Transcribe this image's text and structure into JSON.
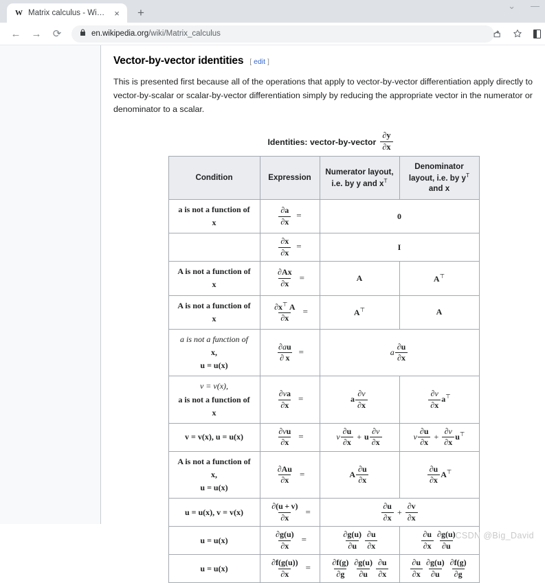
{
  "browser": {
    "tab": {
      "favicon": "W",
      "title": "Matrix calculus - Wikipedia",
      "close": "×"
    },
    "new_tab": "+",
    "window_controls": {
      "minimize_chevron": "⌄",
      "minimize": "—"
    },
    "nav": {
      "back": "←",
      "forward": "→",
      "reload": "⟳"
    },
    "address": {
      "lock": "🔒",
      "domain": "en.wikipedia.org",
      "path": "/wiki/Matrix_calculus"
    },
    "actions": {
      "share": "⤴",
      "bookmark": "☆",
      "sidepanel": "sidepanel"
    }
  },
  "article": {
    "section_title": "Vector-by-vector identities",
    "edit_open": "[",
    "edit_label": "edit",
    "edit_close": "]",
    "intro": "This is presented first because all of the operations that apply to vector-by-vector differentiation apply directly to vector-by-scalar or scalar-by-vector differentiation simply by reducing the appropriate vector in the numerator or denominator to a scalar.",
    "table_caption": "Identities: vector-by-vector",
    "caption_frac": {
      "num": "∂y",
      "den": "∂x"
    }
  },
  "table": {
    "headers": [
      "Condition",
      "Expression",
      "Numerator layout, i.e. by y and xᵀ",
      "Denominator layout, i.e. by yᵀ and x"
    ],
    "header_parts": {
      "numerator": {
        "line1": "Numerator layout,",
        "line2a": "i.e. by y and x",
        "line2b": "T"
      },
      "denominator": {
        "line1": "Denominator",
        "line2a": "layout, i.e. by y",
        "line2b": "T",
        "line3": "and x"
      }
    },
    "rows": [
      {
        "condition": "a is not a function of x",
        "condition_lines": [
          "a is not a function of",
          "x"
        ],
        "expression": "∂a / ∂x =",
        "expr_num": "∂a",
        "expr_den": "∂x",
        "merged": true,
        "result": "0"
      },
      {
        "condition": "",
        "condition_lines": [
          ""
        ],
        "expression": "∂x / ∂x =",
        "expr_num": "∂x",
        "expr_den": "∂x",
        "merged": true,
        "result": "I"
      },
      {
        "condition": "A is not a function of x",
        "condition_lines": [
          "A is not a function of",
          "x"
        ],
        "expression": "∂Ax / ∂x =",
        "expr_num": "∂Ax",
        "expr_den": "∂x",
        "merged": false,
        "numerator": "A",
        "denominator": "Aᵀ"
      },
      {
        "condition": "A is not a function of x",
        "condition_lines": [
          "A is not a function of",
          "x"
        ],
        "expression": "∂xᵀA / ∂x =",
        "expr_num": "∂xᵀA",
        "expr_den": "∂x",
        "merged": false,
        "numerator": "Aᵀ",
        "denominator": "A"
      },
      {
        "condition": "a is not a function of x, u = u(x)",
        "condition_lines": [
          "a is not a function of",
          "x,",
          "u = u(x)"
        ],
        "expression": "∂au / ∂x =",
        "expr_num": "∂au",
        "expr_den": "∂ x",
        "merged": true,
        "result": "a ∂u/∂x"
      },
      {
        "condition": "v = v(x), a is not a function of x",
        "condition_lines": [
          "v = v(x),",
          "a is not a function of",
          "x"
        ],
        "expression": "∂va / ∂x =",
        "expr_num": "∂va",
        "expr_den": "∂x",
        "merged": false,
        "numerator": "a ∂v/∂x",
        "denominator": "∂v/∂x aᵀ"
      },
      {
        "condition": "v = v(x), u = u(x)",
        "condition_lines": [
          "v = v(x), u = u(x)"
        ],
        "expression": "∂vu / ∂x =",
        "expr_num": "∂vu",
        "expr_den": "∂x",
        "merged": false,
        "numerator": "v ∂u/∂x + u ∂v/∂x",
        "denominator": "v ∂u/∂x + ∂v/∂x uᵀ"
      },
      {
        "condition": "A is not a function of x, u = u(x)",
        "condition_lines": [
          "A is not a function of",
          "x,",
          "u = u(x)"
        ],
        "expression": "∂Au / ∂x =",
        "expr_num": "∂Au",
        "expr_den": "∂x",
        "merged": false,
        "numerator": "A ∂u/∂x",
        "denominator": "∂u/∂x Aᵀ"
      },
      {
        "condition": "u = u(x), v = v(x)",
        "condition_lines": [
          "u = u(x), v = v(x)"
        ],
        "expression": "∂(u + v) / ∂x =",
        "expr_num": "∂(u + v)",
        "expr_den": "∂x",
        "merged": true,
        "result": "∂u/∂x + ∂v/∂x"
      },
      {
        "condition": "u = u(x)",
        "condition_lines": [
          "u = u(x)"
        ],
        "expression": "∂g(u) / ∂x =",
        "expr_num": "∂g(u)",
        "expr_den": "∂x",
        "merged": false,
        "numerator": "∂g(u)/∂u ∂u/∂x",
        "denominator": "∂u/∂x ∂g(u)/∂u"
      },
      {
        "condition": "u = u(x)",
        "condition_lines": [
          "u = u(x)"
        ],
        "expression": "∂f(g(u)) / ∂x =",
        "expr_num": "∂f(g(u))",
        "expr_den": "∂x",
        "merged": false,
        "numerator": "∂f(g)/∂g ∂g(u)/∂u ∂u/∂x",
        "denominator": "∂u/∂x ∂g(u)/∂u ∂f(g)/∂g"
      }
    ]
  },
  "watermark": "CSDN @Big_David",
  "colors": {
    "tabstrip": "#dee1e6",
    "table_header": "#eaecf0",
    "table_border": "#a2a9b1",
    "wiki_sidebar": "#f8f9fa",
    "link": "#3366cc",
    "watermark": "#c9c9c9"
  }
}
